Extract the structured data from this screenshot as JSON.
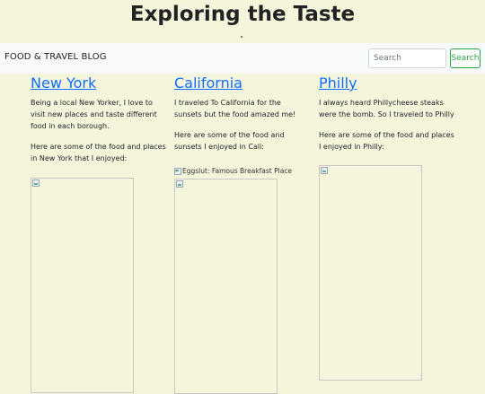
{
  "site": {
    "title": "Exploring the Taste"
  },
  "navbar": {
    "brand": "FOOD & TRAVEL BLOG",
    "search_placeholder": "Search",
    "search_button": "Search"
  },
  "columns": [
    {
      "heading": "New York",
      "intro": "Being a local New Yorker, I love to visit new places and taste different food in each borough.",
      "subtext": "Here are some of the food and places in New York that I enjoyed:"
    },
    {
      "heading": "California",
      "intro": "I traveled To California for the sunsets but the food amazed me!",
      "subtext": "Here are some of the food and sunsets I enjoyed in Cali:",
      "image_alt": "Eggslut: Famous Breakfast Place"
    },
    {
      "heading": "Philly",
      "intro": "I always heard Phillycheese steaks were the bomb. So I traveled to Philly",
      "subtext": "Here are some of the food and places I enjoyed in Philly:"
    }
  ]
}
